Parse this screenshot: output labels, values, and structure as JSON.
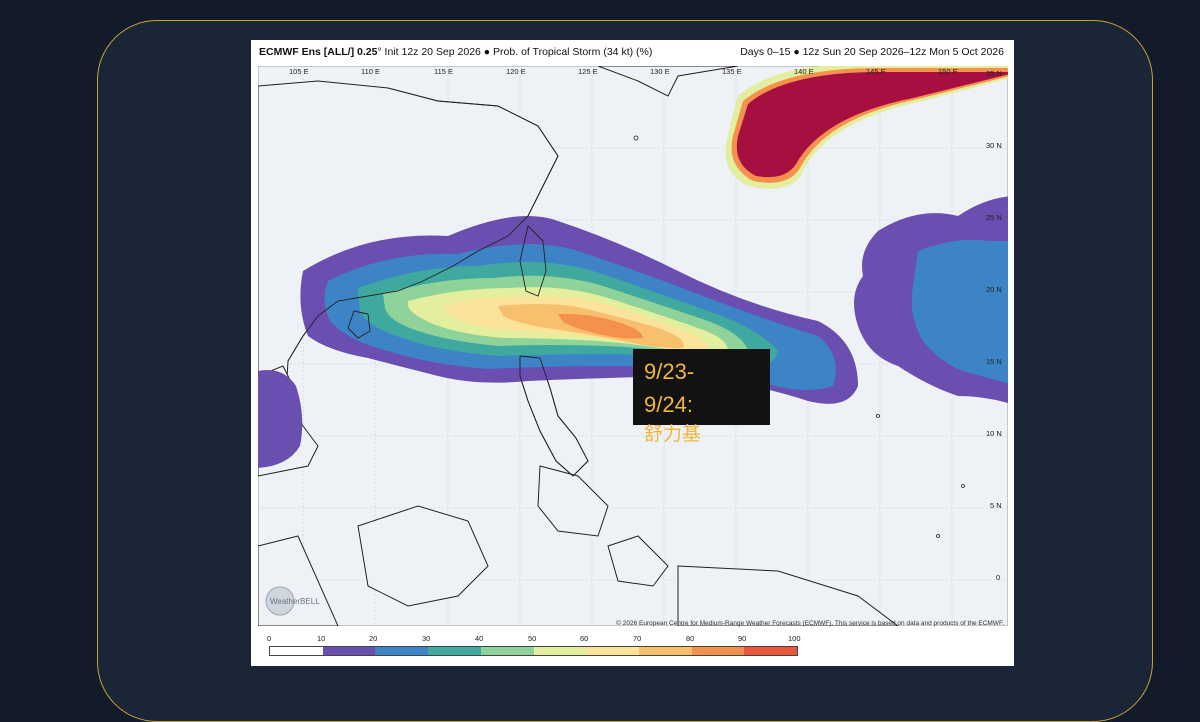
{
  "header": {
    "model": "ECMWF Ens [ALL/] 0.25",
    "init": "° Init 12z 20 Sep 2026 ● Prob. of Tropical Storm (34 kt) (%)",
    "range": "Days 0–15 ● 12z Sun 20 Sep 2026–12z Mon 5 Oct 2026"
  },
  "lon_labels": [
    "105 E",
    "110 E",
    "115 E",
    "120 E",
    "125 E",
    "130 E",
    "135 E",
    "140 E",
    "145 E",
    "150 E"
  ],
  "lat_labels": [
    "35 N",
    "30 N",
    "25 N",
    "20 N",
    "15 N",
    "10 N",
    "5 N",
    "0"
  ],
  "callout": {
    "line1": "9/23-",
    "line2": "9/24:",
    "line3": "舒力基"
  },
  "footer": {
    "watermark": "WeatherBELL",
    "credit": "© 2026 European Centre for Medium-Range Weather Forecasts (ECMWF). This service is based on data and products of the ECMWF."
  },
  "colorbar": {
    "ticks": [
      "0",
      "10",
      "20",
      "30",
      "40",
      "50",
      "60",
      "70",
      "80",
      "90",
      "100"
    ],
    "colors": [
      "#ffffff",
      "#6a4fb0",
      "#3d84c6",
      "#3fa9a0",
      "#8fd39a",
      "#e3ef9e",
      "#fbe49a",
      "#f8c06e",
      "#f3914d",
      "#e8573c",
      "#a60f3f"
    ]
  }
}
